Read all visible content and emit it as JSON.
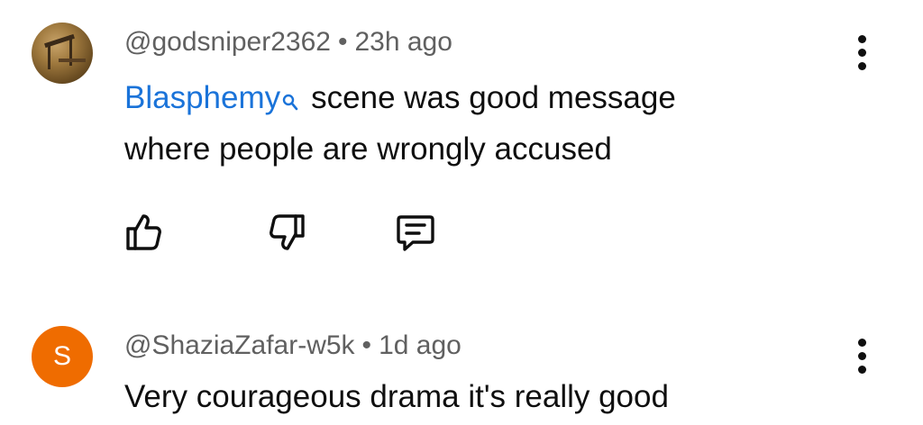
{
  "comments": [
    {
      "avatar_icon": "photo-avatar",
      "author": "@godsniper2362",
      "separator": "•",
      "time": "23h ago",
      "link_text": "Blasphemy",
      "text_line1": "scene was good  message",
      "text_line2": "where people are wrongly accused",
      "actions": {
        "like_icon": "thumbs-up-icon",
        "dislike_icon": "thumbs-down-icon",
        "reply_icon": "reply-icon"
      },
      "menu_icon": "more-vert-icon"
    },
    {
      "avatar_letter": "S",
      "avatar_color": "#ef6c00",
      "author": "@ShaziaZafar-w5k",
      "separator": "•",
      "time": "1d ago",
      "text_line1": "Very courageous drama it's really good",
      "menu_icon": "more-vert-icon"
    }
  ],
  "colors": {
    "link": "#1a73d9",
    "meta": "#606060",
    "text": "#0f0f0f",
    "background": "#ffffff"
  }
}
